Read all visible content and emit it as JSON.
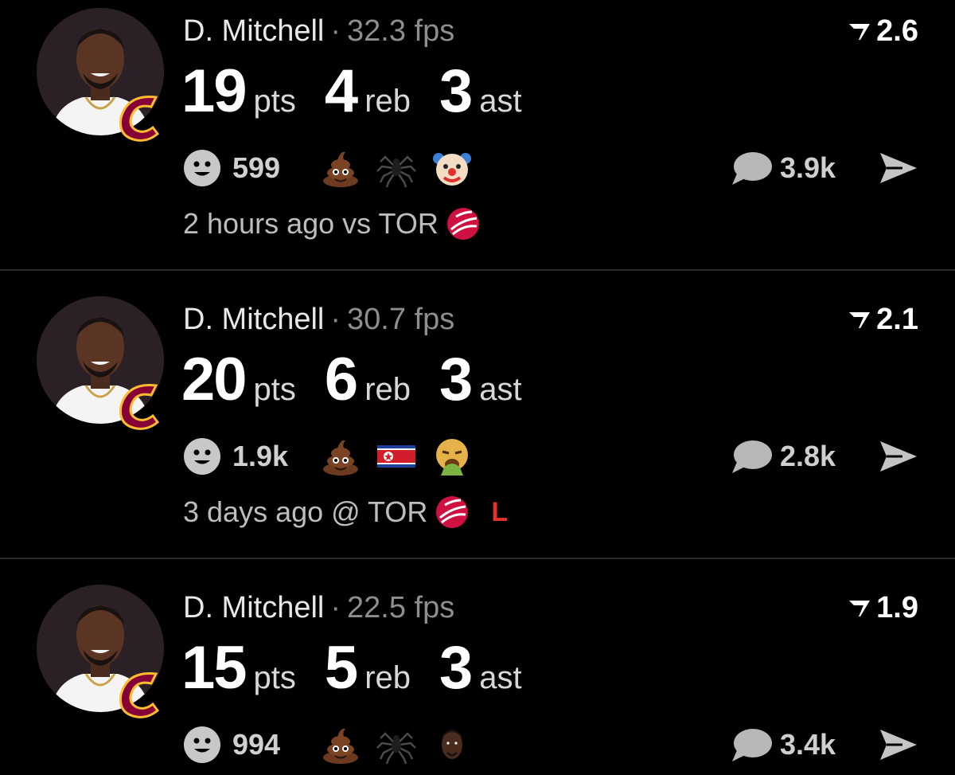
{
  "feed": {
    "posts": [
      {
        "player_name": "D. Mitchell",
        "separator": "·",
        "fps": "32.3 fps",
        "rating": "2.6",
        "stats": [
          {
            "value": "19",
            "unit": "pts"
          },
          {
            "value": "4",
            "unit": "reb"
          },
          {
            "value": "3",
            "unit": "ast"
          }
        ],
        "reaction_count": "599",
        "reaction_emojis": [
          "poop-emoji",
          "spider-emoji",
          "clown-emoji"
        ],
        "comment_count": "3.9k",
        "time_ago": "2 hours ago",
        "matchup": "vs TOR",
        "result": ""
      },
      {
        "player_name": "D. Mitchell",
        "separator": "·",
        "fps": "30.7 fps",
        "rating": "2.1",
        "stats": [
          {
            "value": "20",
            "unit": "pts"
          },
          {
            "value": "6",
            "unit": "reb"
          },
          {
            "value": "3",
            "unit": "ast"
          }
        ],
        "reaction_count": "1.9k",
        "reaction_emojis": [
          "poop-emoji",
          "north-korea-flag-emoji",
          "vomiting-face-emoji"
        ],
        "comment_count": "2.8k",
        "time_ago": "3 days ago",
        "matchup": "@ TOR",
        "result": "L"
      },
      {
        "player_name": "D. Mitchell",
        "separator": "·",
        "fps": "22.5 fps",
        "rating": "1.9",
        "stats": [
          {
            "value": "15",
            "unit": "pts"
          },
          {
            "value": "5",
            "unit": "reb"
          },
          {
            "value": "3",
            "unit": "ast"
          }
        ],
        "reaction_count": "994",
        "reaction_emojis": [
          "poop-emoji",
          "spider-emoji",
          "player-face-emoji"
        ],
        "comment_count": "3.4k",
        "time_ago": "",
        "matchup": "",
        "result": ""
      }
    ]
  },
  "colors": {
    "background": "#000000",
    "divider": "#2a2a2a",
    "loss_red": "#e5322d",
    "cavs_wine": "#860038",
    "cavs_gold": "#fdbb30",
    "raptors_red": "#ce1141"
  }
}
